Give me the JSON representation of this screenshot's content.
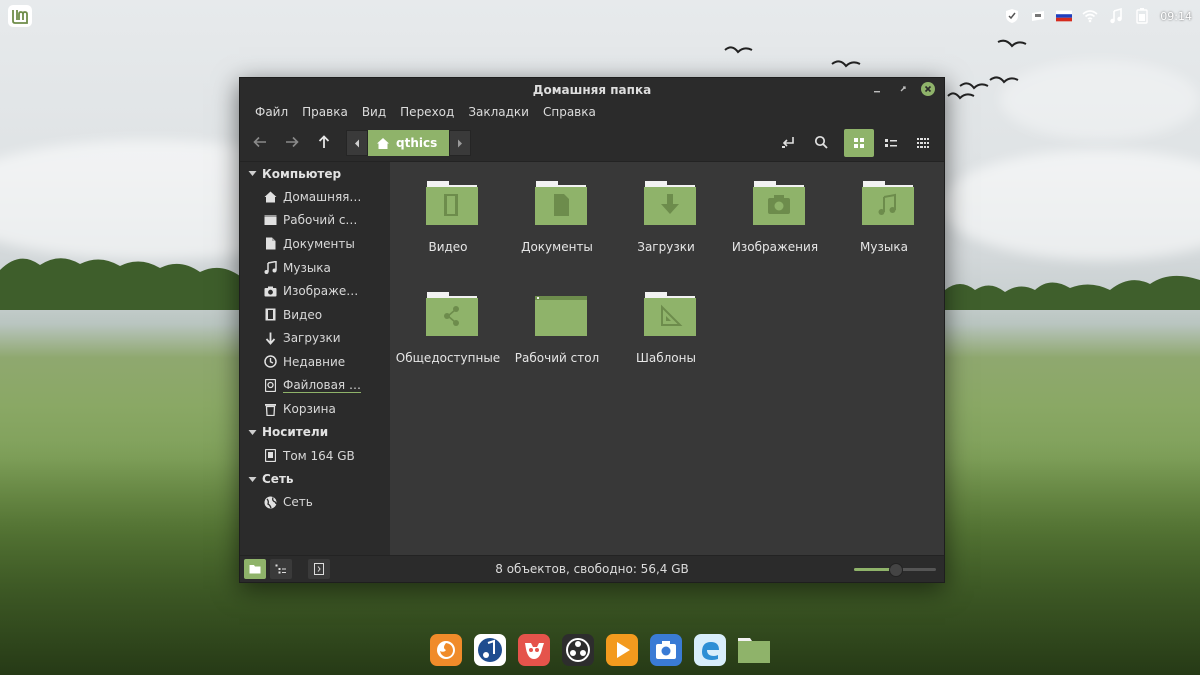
{
  "colors": {
    "accent": "#8fb36a",
    "window_bg": "#2b2b2b",
    "content_bg": "#383838",
    "text": "#dcdcdc"
  },
  "panel": {
    "logo": "linux-mint-logo",
    "tray_icons": [
      "shield-icon",
      "network-card-icon",
      "russian-flag-icon",
      "wifi-icon",
      "music-note-icon",
      "battery-icon"
    ],
    "clock": "09:14"
  },
  "window": {
    "title": "Домашняя папка",
    "menu": [
      "Файл",
      "Правка",
      "Вид",
      "Переход",
      "Закладки",
      "Справка"
    ],
    "path": {
      "current": "qthics"
    },
    "sidebar": {
      "sections": [
        {
          "title": "Компьютер",
          "items": [
            {
              "label": "Домашняя…",
              "icon": "home-icon"
            },
            {
              "label": "Рабочий с…",
              "icon": "desktop-icon"
            },
            {
              "label": "Документы",
              "icon": "document-icon"
            },
            {
              "label": "Музыка",
              "icon": "music-icon"
            },
            {
              "label": "Изображе…",
              "icon": "camera-icon"
            },
            {
              "label": "Видео",
              "icon": "film-icon"
            },
            {
              "label": "Загрузки",
              "icon": "download-icon"
            },
            {
              "label": "Недавние",
              "icon": "clock-icon"
            },
            {
              "label": "Файловая …",
              "icon": "drive-icon"
            },
            {
              "label": "Корзина",
              "icon": "trash-icon"
            }
          ]
        },
        {
          "title": "Носители",
          "items": [
            {
              "label": "Том 164 GB",
              "icon": "drive-icon"
            }
          ]
        },
        {
          "title": "Сеть",
          "items": [
            {
              "label": "Сеть",
              "icon": "globe-icon"
            }
          ]
        }
      ]
    },
    "files": [
      {
        "label": "Видео",
        "emblem": "film"
      },
      {
        "label": "Документы",
        "emblem": "document"
      },
      {
        "label": "Загрузки",
        "emblem": "download"
      },
      {
        "label": "Изображения",
        "emblem": "camera"
      },
      {
        "label": "Музыка",
        "emblem": "music"
      },
      {
        "label": "Общедоступные",
        "emblem": "share"
      },
      {
        "label": "Рабочий стол",
        "emblem": "desktop"
      },
      {
        "label": "Шаблоны",
        "emblem": "template"
      }
    ],
    "status": "8 объектов, свободно: 56,4 GB",
    "zoom_fraction": 0.5
  },
  "dock": [
    "firefox-icon",
    "rhythmbox-icon",
    "gimp-icon",
    "obs-icon",
    "media-player-icon",
    "screenshot-icon",
    "edge-browser-icon",
    "files-folder-icon"
  ]
}
